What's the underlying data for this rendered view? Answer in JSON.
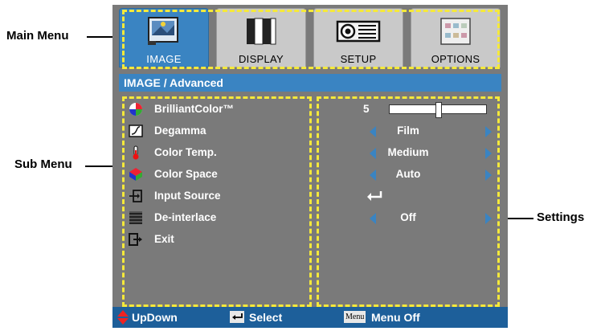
{
  "callouts": {
    "main_menu": "Main Menu",
    "sub_menu": "Sub Menu",
    "settings": "Settings"
  },
  "tabs": [
    {
      "label": "IMAGE",
      "icon": "image-icon",
      "active": true
    },
    {
      "label": "DISPLAY",
      "icon": "display-icon",
      "active": false
    },
    {
      "label": "SETUP",
      "icon": "projector-icon",
      "active": false
    },
    {
      "label": "OPTIONS",
      "icon": "options-icon",
      "active": false
    }
  ],
  "breadcrumb": "IMAGE / Advanced",
  "submenu": [
    {
      "label": "BrilliantColor™",
      "icon": "brilliantcolor-icon"
    },
    {
      "label": "Degamma",
      "icon": "degamma-icon"
    },
    {
      "label": "Color Temp.",
      "icon": "thermometer-icon"
    },
    {
      "label": "Color Space",
      "icon": "color-space-icon"
    },
    {
      "label": "Input Source",
      "icon": "input-source-icon"
    },
    {
      "label": "De-interlace",
      "icon": "deinterlace-icon"
    },
    {
      "label": "Exit",
      "icon": "exit-icon"
    }
  ],
  "settings": {
    "brilliantcolor": {
      "value": "5",
      "slider_fraction": 0.5
    },
    "degamma": "Film",
    "color_temp": "Medium",
    "color_space": "Auto",
    "de_interlace": "Off"
  },
  "footer": {
    "updown": "UpDown",
    "select": "Select",
    "menu_chip": "Menu",
    "menu_off": "Menu Off"
  },
  "colors": {
    "accent_blue": "#3a84c2",
    "footer_blue": "#1d5f9a",
    "panel_gray": "#7a7a7a",
    "highlight_dash": "#f5e93a"
  }
}
